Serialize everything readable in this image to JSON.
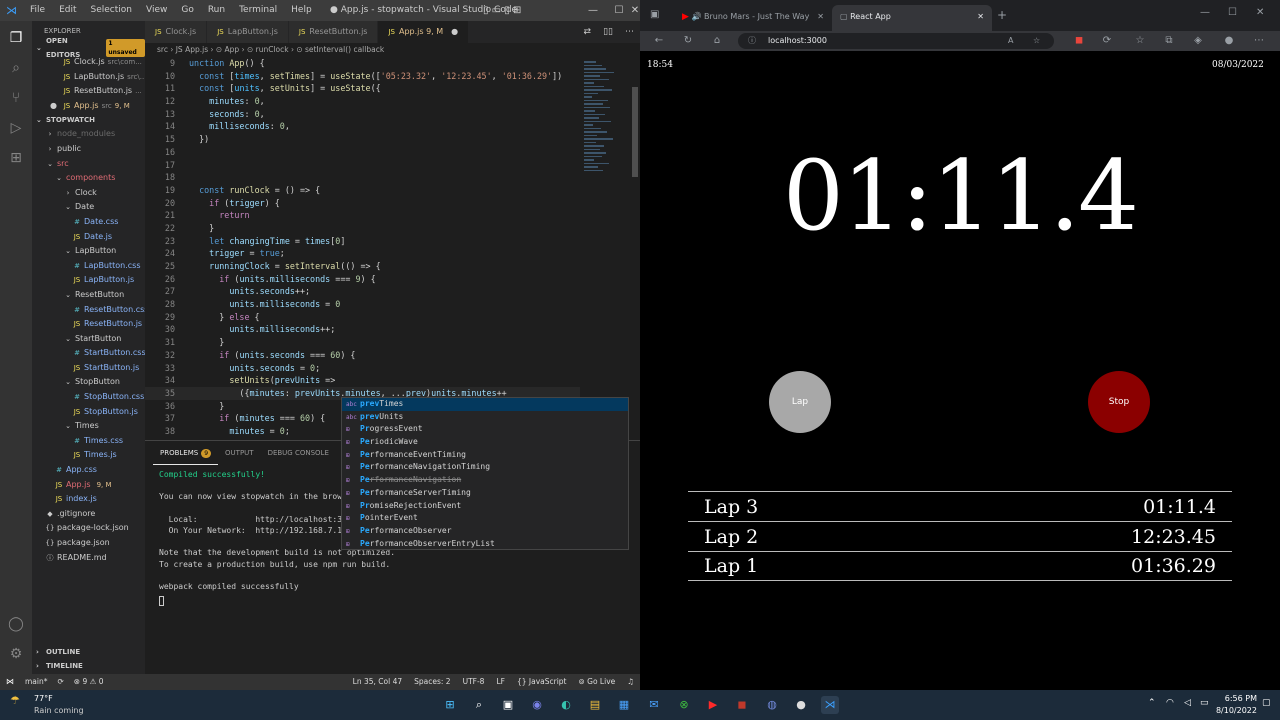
{
  "vscode": {
    "menu": [
      "File",
      "Edit",
      "Selection",
      "View",
      "Go",
      "Run",
      "Terminal",
      "Help"
    ],
    "title": "● App.js - stopwatch - Visual Studio Code",
    "explorer_title": "EXPLORER",
    "open_editors": "OPEN EDITORS",
    "unsaved": "1 unsaved",
    "open_files": [
      {
        "name": "Clock.js",
        "desc": "src\\com..."
      },
      {
        "name": "LapButton.js",
        "desc": "src\\..."
      },
      {
        "name": "ResetButton.js",
        "desc": "..."
      },
      {
        "name": "App.js",
        "desc": "src",
        "badge": "9, M"
      }
    ],
    "project": "STOPWATCH",
    "tree": [
      {
        "name": "node_modules",
        "indent": 1,
        "icon": "›",
        "color": "#6b6b6b"
      },
      {
        "name": "public",
        "indent": 1,
        "icon": "›",
        "color": "#ccc"
      },
      {
        "name": "src",
        "indent": 1,
        "icon": "⌄",
        "color": "#e06c75"
      },
      {
        "name": "components",
        "indent": 2,
        "icon": "⌄",
        "color": "#e06c75"
      },
      {
        "name": "Clock",
        "indent": 3,
        "icon": "›",
        "color": "#ccc"
      },
      {
        "name": "Date",
        "indent": 3,
        "icon": "⌄",
        "color": "#ccc"
      },
      {
        "name": "Date.css",
        "indent": 4,
        "icon": "#",
        "color": "#8ab4f8"
      },
      {
        "name": "Date.js",
        "indent": 4,
        "icon": "JS",
        "color": "#8ab4f8"
      },
      {
        "name": "LapButton",
        "indent": 3,
        "icon": "⌄",
        "color": "#ccc"
      },
      {
        "name": "LapButton.css",
        "indent": 4,
        "icon": "#",
        "color": "#8ab4f8"
      },
      {
        "name": "LapButton.js",
        "indent": 4,
        "icon": "JS",
        "color": "#8ab4f8"
      },
      {
        "name": "ResetButton",
        "indent": 3,
        "icon": "⌄",
        "color": "#ccc"
      },
      {
        "name": "ResetButton.css",
        "indent": 4,
        "icon": "#",
        "color": "#8ab4f8"
      },
      {
        "name": "ResetButton.js",
        "indent": 4,
        "icon": "JS",
        "color": "#8ab4f8"
      },
      {
        "name": "StartButton",
        "indent": 3,
        "icon": "⌄",
        "color": "#ccc"
      },
      {
        "name": "StartButton.css",
        "indent": 4,
        "icon": "#",
        "color": "#8ab4f8"
      },
      {
        "name": "StartButton.js",
        "indent": 4,
        "icon": "JS",
        "color": "#8ab4f8"
      },
      {
        "name": "StopButton",
        "indent": 3,
        "icon": "⌄",
        "color": "#ccc"
      },
      {
        "name": "StopButton.css",
        "indent": 4,
        "icon": "#",
        "color": "#8ab4f8"
      },
      {
        "name": "StopButton.js",
        "indent": 4,
        "icon": "JS",
        "color": "#8ab4f8"
      },
      {
        "name": "Times",
        "indent": 3,
        "icon": "⌄",
        "color": "#ccc"
      },
      {
        "name": "Times.css",
        "indent": 4,
        "icon": "#",
        "color": "#8ab4f8"
      },
      {
        "name": "Times.js",
        "indent": 4,
        "icon": "JS",
        "color": "#8ab4f8"
      },
      {
        "name": "App.css",
        "indent": 2,
        "icon": "#",
        "color": "#8ab4f8"
      },
      {
        "name": "App.js",
        "indent": 2,
        "icon": "JS",
        "color": "#e06c75",
        "badge": "9, M"
      },
      {
        "name": "index.js",
        "indent": 2,
        "icon": "JS",
        "color": "#8ab4f8"
      },
      {
        "name": ".gitignore",
        "indent": 1,
        "icon": "◆",
        "color": "#ccc"
      },
      {
        "name": "package-lock.json",
        "indent": 1,
        "icon": "{}",
        "color": "#ccc"
      },
      {
        "name": "package.json",
        "indent": 1,
        "icon": "{}",
        "color": "#ccc"
      },
      {
        "name": "README.md",
        "indent": 1,
        "icon": "ⓘ",
        "color": "#ccc"
      }
    ],
    "outline": "OUTLINE",
    "timeline": "TIMELINE",
    "tabs": [
      {
        "name": "Clock.js",
        "active": false
      },
      {
        "name": "LapButton.js",
        "active": false
      },
      {
        "name": "ResetButton.js",
        "active": false
      },
      {
        "name": "App.js 9, M",
        "active": true
      }
    ],
    "breadcrumb": "src › JS App.js › ⊙ App › ⊙ runClock › ⊙ setInterval() callback",
    "code": [
      {
        "n": "9",
        "html": "<span class='kw'>unction</span> <span class='f'>App</span>() {"
      },
      {
        "n": "10",
        "html": "  <span class='kw'>const</span> [<span class='c'>times</span>, <span class='f'>setTimes</span>] = <span class='f'>useState</span>([<span class='s'>'05:23.32'</span>, <span class='s'>'12:23.45'</span>, <span class='s'>'01:36.29'</span>])"
      },
      {
        "n": "11",
        "html": "  <span class='kw'>const</span> [<span class='c'>units</span>, <span class='f'>setUnits</span>] = <span class='f'>useState</span>({"
      },
      {
        "n": "12",
        "html": "    <span class='v'>minutes</span>: <span class='n'>0</span>,"
      },
      {
        "n": "13",
        "html": "    <span class='v'>seconds</span>: <span class='n'>0</span>,"
      },
      {
        "n": "14",
        "html": "    <span class='v'>milliseconds</span>: <span class='n'>0</span>,"
      },
      {
        "n": "15",
        "html": "  })"
      },
      {
        "n": "16",
        "html": ""
      },
      {
        "n": "17",
        "html": ""
      },
      {
        "n": "18",
        "html": ""
      },
      {
        "n": "19",
        "html": "  <span class='kw'>const</span> <span class='f'>runClock</span> = () => {"
      },
      {
        "n": "20",
        "html": "    <span class='k'>if</span> (<span class='v'>trigger</span>) {"
      },
      {
        "n": "21",
        "html": "      <span class='k'>return</span>"
      },
      {
        "n": "22",
        "html": "    }"
      },
      {
        "n": "23",
        "html": "    <span class='kw'>let</span> <span class='v'>changingTime</span> = <span class='v'>times</span>[<span class='n'>0</span>]"
      },
      {
        "n": "24",
        "html": "    <span class='v'>trigger</span> = <span class='kw'>true</span>;"
      },
      {
        "n": "25",
        "html": "    <span class='v'>runningClock</span> = <span class='f'>setInterval</span>(() => {"
      },
      {
        "n": "26",
        "html": "      <span class='k'>if</span> (<span class='v'>units</span>.<span class='v'>milliseconds</span> === <span class='n'>9</span>) {"
      },
      {
        "n": "27",
        "html": "        <span class='v'>units</span>.<span class='v'>seconds</span>++;"
      },
      {
        "n": "28",
        "html": "        <span class='v'>units</span>.<span class='v'>milliseconds</span> = <span class='n'>0</span>"
      },
      {
        "n": "29",
        "html": "      } <span class='k'>else</span> {"
      },
      {
        "n": "30",
        "html": "        <span class='v'>units</span>.<span class='v'>milliseconds</span>++;"
      },
      {
        "n": "31",
        "html": "      }"
      },
      {
        "n": "32",
        "html": "      <span class='k'>if</span> (<span class='v'>units</span>.<span class='v'>seconds</span> === <span class='n'>60</span>) {"
      },
      {
        "n": "33",
        "html": "        <span class='v'>units</span>.<span class='v'>seconds</span> = <span class='n'>0</span>;"
      },
      {
        "n": "34",
        "html": "        <span class='f'>setUnits</span>(<span class='v'>prevUnits</span> =>"
      },
      {
        "n": "35",
        "html": "          ({<span class='v'>minutes</span>: <span class='v'>prevUnits</span>.<span class='v'>minutes</span>, ...<span class='v'>prev</span>)<span class='v'>units</span>.<span class='v'>minutes</span>++"
      },
      {
        "n": "36",
        "html": "      }"
      },
      {
        "n": "37",
        "html": "      <span class='k'>if</span> (<span class='v'>minutes</span> === <span class='n'>60</span>) {"
      },
      {
        "n": "38",
        "html": "        <span class='v'>minutes</span> = <span class='n'>0</span>;"
      }
    ],
    "suggestions": [
      {
        "hl": "prev",
        "rest": "Times",
        "icon": "abc",
        "sel": true
      },
      {
        "hl": "prev",
        "rest": "Units",
        "icon": "abc"
      },
      {
        "hl": "Pr",
        "rest": "ogressEvent",
        "icon": "⊞"
      },
      {
        "hl": "Pe",
        "rest": "riodicWave",
        "icon": "⊞"
      },
      {
        "hl": "Pe",
        "rest": "rformanceEventTiming",
        "icon": "⊞"
      },
      {
        "hl": "Pe",
        "rest": "rformanceNavigationTiming",
        "icon": "⊞"
      },
      {
        "hl": "Pe",
        "rest": "rformanceNavigation",
        "icon": "⊞",
        "dim": true
      },
      {
        "hl": "Pe",
        "rest": "rformanceServerTiming",
        "icon": "⊞"
      },
      {
        "hl": "Pr",
        "rest": "omiseRejectionEvent",
        "icon": "⊞"
      },
      {
        "hl": "P",
        "rest": "ointerEvent",
        "icon": "⊞"
      },
      {
        "hl": "Pe",
        "rest": "rformanceObserver",
        "icon": "⊞"
      },
      {
        "hl": "Pe",
        "rest": "rformanceObserverEntryList",
        "icon": "⊞"
      }
    ],
    "panel_tabs": [
      {
        "label": "PROBLEMS",
        "badge": "9"
      },
      {
        "label": "OUTPUT"
      },
      {
        "label": "DEBUG CONSOLE"
      }
    ],
    "terminal": [
      {
        "t": "Compiled successfully!",
        "c": "#23d18b"
      },
      {
        "t": "",
        "c": "#ccc"
      },
      {
        "t": "You can now view stopwatch in the brows",
        "c": "#ccc"
      },
      {
        "t": "",
        "c": "#ccc"
      },
      {
        "t": "  Local:            http://localhost:30",
        "c": "#ccc"
      },
      {
        "t": "  On Your Network:  http://192.168.7.17",
        "c": "#ccc"
      },
      {
        "t": "",
        "c": "#ccc"
      },
      {
        "t": "Note that the development build is not optimized.",
        "c": "#ccc"
      },
      {
        "t": "To create a production build, use npm run build.",
        "c": "#ccc"
      },
      {
        "t": "",
        "c": "#ccc"
      },
      {
        "t": "webpack compiled successfully",
        "c": "#ccc"
      }
    ],
    "status": {
      "branch": "main*",
      "sync": "⟳",
      "errors": "⊗ 9 ⚠ 0",
      "position": "Ln 35, Col 47",
      "spaces": "Spaces: 2",
      "encoding": "UTF-8",
      "eol": "LF",
      "language": "{} JavaScript",
      "golive": "⊚ Go Live"
    }
  },
  "browser": {
    "tabs": [
      {
        "title": "Bruno Mars - Just The Way",
        "active": false
      },
      {
        "title": "React App",
        "active": true
      }
    ],
    "url": "localhost:3000"
  },
  "app": {
    "time_of_day": "18:54",
    "date": "08/03/2022",
    "clock": "01:11.4",
    "lap_label": "Lap",
    "stop_label": "Stop",
    "laps": [
      {
        "name": "Lap 3",
        "time": "01:11.4"
      },
      {
        "name": "Lap 2",
        "time": "12:23.45"
      },
      {
        "name": "Lap 1",
        "time": "01:36.29"
      }
    ]
  },
  "taskbar": {
    "weather_temp": "77°F",
    "weather_desc": "Rain coming",
    "time": "6:56 PM",
    "date": "8/10/2022"
  },
  "colors": {
    "lap_btn": "#a8a8a8",
    "stop_btn": "#8b0000",
    "accent": "#007acc"
  }
}
